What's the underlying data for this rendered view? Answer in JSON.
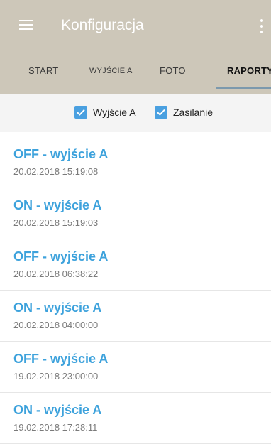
{
  "app_bar": {
    "title": "Konfiguracja",
    "background_color": "#cdc7b9",
    "menu_icon": "hamburger-menu-icon",
    "overflow_icon": "more-vert-icon"
  },
  "tabs": [
    {
      "label": "START",
      "active": false
    },
    {
      "label": "WYJŚCIE A",
      "active": false
    },
    {
      "label": "FOTO",
      "active": false
    },
    {
      "label": "RAPORTY",
      "active": true
    }
  ],
  "filters": [
    {
      "label": "Wyjście A",
      "checked": true
    },
    {
      "label": "Zasilanie",
      "checked": true
    }
  ],
  "accent_color": "#3da2dc",
  "reports": [
    {
      "title": "OFF - wyjście A",
      "timestamp": "20.02.2018 15:19:08"
    },
    {
      "title": "ON - wyjście A",
      "timestamp": "20.02.2018 15:19:03"
    },
    {
      "title": "OFF - wyjście A",
      "timestamp": "20.02.2018 06:38:22"
    },
    {
      "title": "ON - wyjście A",
      "timestamp": "20.02.2018 04:00:00"
    },
    {
      "title": "OFF - wyjście A",
      "timestamp": "19.02.2018 23:00:00"
    },
    {
      "title": "ON - wyjście A",
      "timestamp": "19.02.2018 17:28:11"
    }
  ]
}
